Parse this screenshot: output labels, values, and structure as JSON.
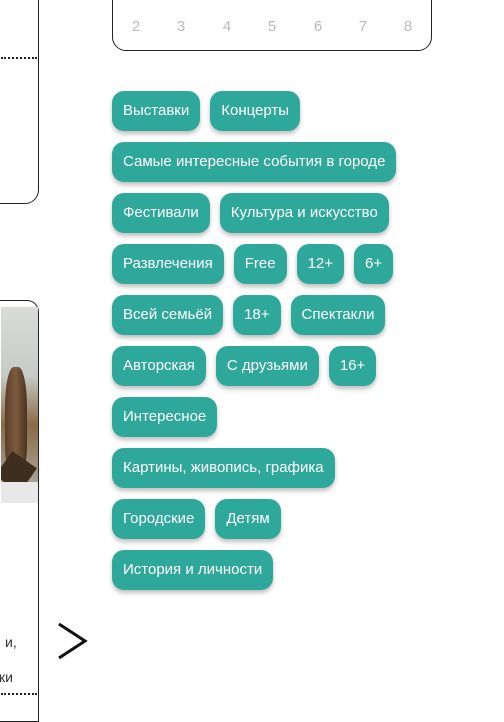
{
  "pagination": {
    "pages": [
      "2",
      "3",
      "4",
      "5",
      "6",
      "7",
      "8"
    ]
  },
  "card_bottom": {
    "text_line1": "и,",
    "text_line2": "ки"
  },
  "tags": [
    [
      "Выставки",
      "Концерты"
    ],
    [
      "Самые интересные события в городе"
    ],
    [
      "Фестивали",
      "Культура и искусство"
    ],
    [
      "Развлечения",
      "Free",
      "12+",
      "6+"
    ],
    [
      "Всей семьёй",
      "18+",
      "Спектакли"
    ],
    [
      "Авторская",
      "С друзьями",
      "16+"
    ],
    [
      "Интересное"
    ],
    [
      "Картины, живопись, графика"
    ],
    [
      "Городские",
      "Детям"
    ],
    [
      "История и личности"
    ]
  ],
  "icons": {
    "next": "chevron-right-icon"
  },
  "colors": {
    "tag_bg": "#2ea89a",
    "page_num": "#b9b9b9"
  }
}
